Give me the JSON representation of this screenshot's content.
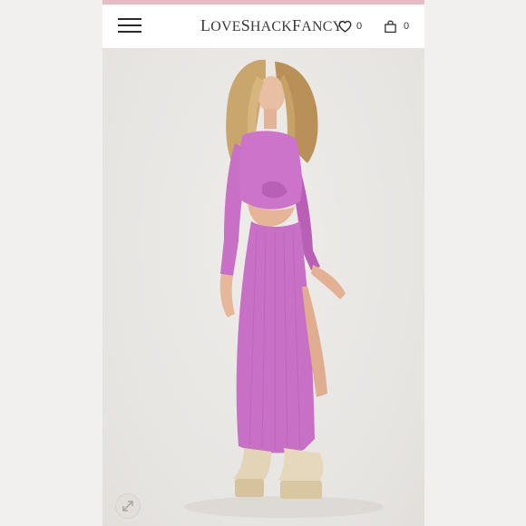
{
  "header": {
    "logo": {
      "initial_1": "L",
      "part_1": "OVE",
      "initial_2": "S",
      "part_2": "HACK",
      "initial_3": "F",
      "part_3": "ANCY"
    },
    "favorites_count": "0",
    "cart_count": "0"
  },
  "icons": {
    "menu": "hamburger-menu-icon",
    "favorites": "heart-icon",
    "cart": "shopping-bag-icon",
    "expand": "expand-arrows-icon"
  },
  "colors": {
    "top_bar": "#e8b9c6",
    "dress": "#c86fc6",
    "background": "#ebe9e6"
  }
}
